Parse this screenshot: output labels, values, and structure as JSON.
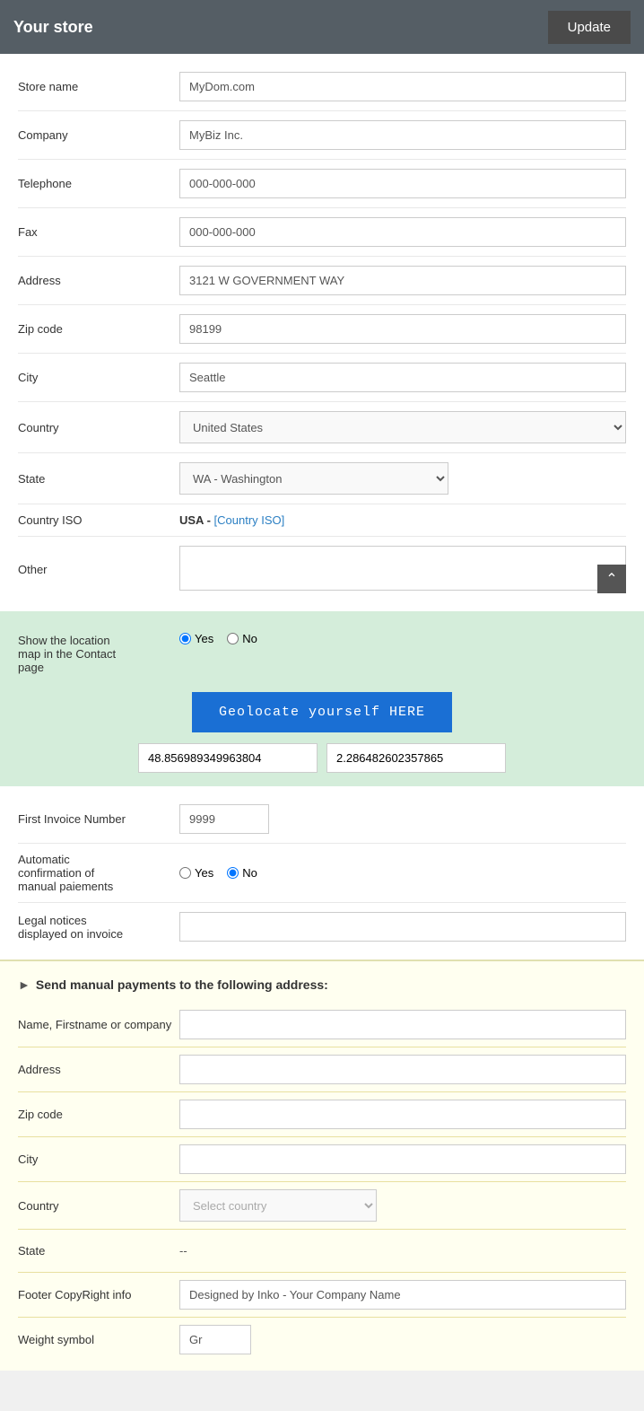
{
  "header": {
    "title": "Your store",
    "update_button": "Update"
  },
  "form": {
    "store_name_label": "Store name",
    "store_name_value": "MyDom.com",
    "company_label": "Company",
    "company_value": "MyBiz Inc.",
    "telephone_label": "Telephone",
    "telephone_value": "000-000-000",
    "fax_label": "Fax",
    "fax_value": "000-000-000",
    "address_label": "Address",
    "address_value": "3121 W GOVERNMENT WAY",
    "zip_label": "Zip code",
    "zip_value": "98199",
    "city_label": "City",
    "city_value": "Seattle",
    "country_label": "Country",
    "country_value": "United States",
    "state_label": "State",
    "state_value": "WA - Washington",
    "country_iso_label": "Country ISO",
    "country_iso_value": "USA - ",
    "country_iso_link": "[Country ISO]",
    "other_label": "Other"
  },
  "location_map": {
    "label_line1": "Show the location",
    "label_line2": "map in the Contact",
    "label_line3": "page",
    "yes_label": "Yes",
    "no_label": "No",
    "geolocate_btn": "Geolocate yourself HERE",
    "lat_value": "48.856989349963804",
    "lng_value": "2.286482602357865"
  },
  "invoice": {
    "first_invoice_label": "First Invoice Number",
    "first_invoice_value": "9999",
    "auto_confirm_label_line1": "Automatic",
    "auto_confirm_label_line2": "confirmation of",
    "auto_confirm_label_line3": "manual paiements",
    "yes_label": "Yes",
    "no_label": "No",
    "legal_notices_label_line1": "Legal notices",
    "legal_notices_label_line2": "displayed on invoice",
    "legal_notices_value": ""
  },
  "manual_payments": {
    "section_title": "Send manual payments to the following address:",
    "name_label": "Name, Firstname or company",
    "name_value": "",
    "address_label": "Address",
    "address_value": "",
    "zip_label": "Zip code",
    "zip_value": "",
    "city_label": "City",
    "city_value": "",
    "country_label": "Country",
    "country_placeholder": "Select country",
    "state_label": "State",
    "state_value": "--",
    "footer_label": "Footer CopyRight info",
    "footer_value": "Designed by Inko - Your Company Name",
    "weight_label": "Weight symbol",
    "weight_value": "Gr"
  }
}
